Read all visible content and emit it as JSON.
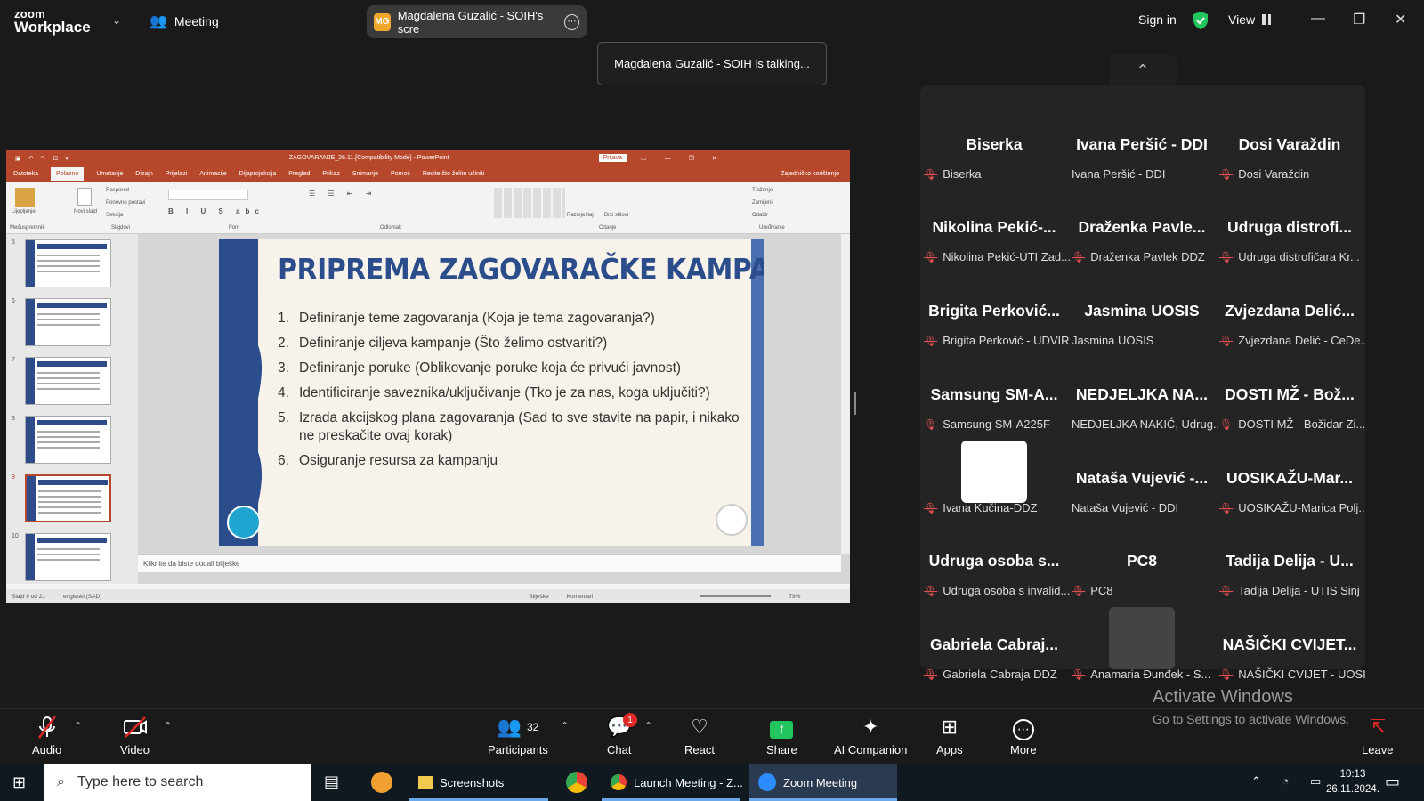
{
  "topbar": {
    "logo_line1": "zoom",
    "logo_line2": "Workplace",
    "meeting_label": "Meeting",
    "share_badge": "MG",
    "share_label": "Magdalena Guzalić - SOIH's scre",
    "sign_in": "Sign in",
    "view_label": "View"
  },
  "toast": {
    "text": "Magdalena Guzalić - SOIH is talking..."
  },
  "ppt": {
    "window_title": "ZAGOVARANJE_26.11.[Compatibility Mode] - PowerPoint",
    "prijava": "Prijava",
    "tabs": [
      "Datoteka",
      "Polazno",
      "Umetanje",
      "Dizajn",
      "Prijelazi",
      "Animacije",
      "Dijaprojekcija",
      "Pregled",
      "Prikaz",
      "Snimanje",
      "Pomoć",
      "Recite što želite učiniti"
    ],
    "share_label": "Zajedničko korištenje",
    "ribbon_groups": [
      "Međuspremnik",
      "Slajdovi",
      "Font",
      "Odlomak",
      "Crtanje",
      "Uređivanje"
    ],
    "ribbon_items": {
      "paste": "Lijepljenje",
      "new_slide": "Novi slajd",
      "layout": "Raspored",
      "reset": "Ponovno postavi",
      "section": "Sekcija",
      "arrange": "Razmještaj",
      "quick_styles": "Brzi stilovi",
      "find": "Traženje",
      "replace": "Zamijeni",
      "select": "Odabir"
    },
    "thumb_numbers": [
      "5",
      "6",
      "7",
      "8",
      "9",
      "10"
    ],
    "slide_title": "PRIPREMA ZAGOVARAČKE KAMPANJE",
    "slide_items": [
      {
        "n": "1.",
        "text": "Definiranje teme zagovaranja (Koja je tema zagovaranja?)"
      },
      {
        "n": "2.",
        "text": "Definiranje ciljeva kampanje (Što želimo ostvariti?)"
      },
      {
        "n": "3.",
        "text": "Definiranje poruke (Oblikovanje poruke koja će privući javnost)"
      },
      {
        "n": "4.",
        "text": "Identificiranje saveznika/uključivanje (Tko je za nas, koga uključiti?)"
      },
      {
        "n": "5.",
        "text": "Izrada akcijskog plana zagovaranja (Sad to sve stavite na papir, i nikako ne preskačite ovaj korak)"
      },
      {
        "n": "6.",
        "text": "Osiguranje resursa za kampanju"
      }
    ],
    "notes_placeholder": "Kliknite da biste dodali bilješke",
    "status_slide": "Slajd 9 od 21",
    "status_lang": "engleski (SAD)",
    "status_notes": "Bilješke",
    "status_comments": "Komentari",
    "zoom_level": "79%"
  },
  "gallery": {
    "tiles": [
      {
        "big": "Biserka",
        "label": "Biserka",
        "muted": true
      },
      {
        "big": "Ivana Peršić - DDI",
        "label": "Ivana Peršić - DDI",
        "muted": false
      },
      {
        "big": "Dosi Varaždin",
        "label": "Dosi Varaždin",
        "muted": true
      },
      {
        "big": "Nikolina Pekić-...",
        "label": "Nikolina Pekić-UTI Zad...",
        "muted": true
      },
      {
        "big": "Draženka Pavle...",
        "label": "Draženka Pavlek DDZ",
        "muted": true
      },
      {
        "big": "Udruga distrofi...",
        "label": "Udruga distrofičara Kr...",
        "muted": true
      },
      {
        "big": "Brigita Perković...",
        "label": "Brigita Perković - UDVIR",
        "muted": true
      },
      {
        "big": "Jasmina UOSIS",
        "label": "Jasmina UOSIS",
        "muted": false
      },
      {
        "big": "Zvjezdana Delić...",
        "label": "Zvjezdana Delić - CeDe...",
        "muted": true
      },
      {
        "big": "Samsung SM-A...",
        "label": "Samsung SM-A225F",
        "muted": true
      },
      {
        "big": "NEDJELJKA NA...",
        "label": "NEDJELJKA NAKIĆ, Udrug...",
        "muted": false
      },
      {
        "big": "DOSTI MŽ - Bož...",
        "label": "DOSTI MŽ - Božidar Zi...",
        "muted": true
      },
      {
        "big": "",
        "label": "Ivana Kučina-DDZ",
        "muted": true
      },
      {
        "big": "Nataša Vujević -...",
        "label": "Nataša Vujević - DDI",
        "muted": false
      },
      {
        "big": "UOSIKAŽU-Mar...",
        "label": "UOSIKAŽU-Marica Polj...",
        "muted": true
      },
      {
        "big": "Udruga osoba s...",
        "label": "Udruga osoba s invalid...",
        "muted": true
      },
      {
        "big": "PC8",
        "label": "PC8",
        "muted": true
      },
      {
        "big": "Tadija Delija - U...",
        "label": "Tadija Delija - UTIS Sinj",
        "muted": true
      },
      {
        "big": "Gabriela Cabraj...",
        "label": "Gabriela Cabraja DDZ",
        "muted": true
      },
      {
        "big": "",
        "label": "Anamaria Đunđek - S...",
        "muted": true
      },
      {
        "big": "NAŠIČKI CVIJET...",
        "label": "NAŠIČKI CVIJET - UOSI...",
        "muted": true
      }
    ]
  },
  "bottombar": {
    "audio": "Audio",
    "video": "Video",
    "participants": "Participants",
    "participants_count": "32",
    "chat": "Chat",
    "chat_badge": "1",
    "react": "React",
    "share": "Share",
    "ai": "AI Companion",
    "apps": "Apps",
    "more": "More",
    "leave": "Leave"
  },
  "activate": {
    "line1": "Activate Windows",
    "line2": "Go to Settings to activate Windows."
  },
  "taskbar": {
    "search_placeholder": "Type here to search",
    "app1": "Screenshots",
    "app2": "Launch Meeting - Z...",
    "app3": "Zoom Meeting",
    "time": "10:13",
    "date": "26.11.2024."
  },
  "colors": {
    "ppt_accent": "#b7472a",
    "slide_blue": "#2b4d8c",
    "share_green": "#22c55e",
    "muted_red": "#e05050"
  }
}
